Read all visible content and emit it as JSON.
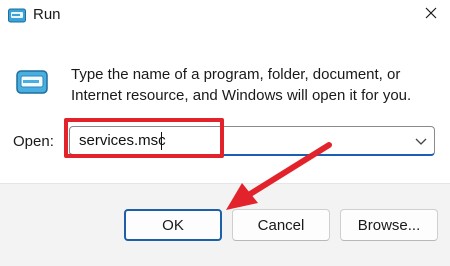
{
  "window": {
    "title": "Run",
    "close_icon": "close-icon",
    "app_icon": "run-icon"
  },
  "body": {
    "description": "Type the name of a program, folder, document, or Internet resource, and Windows will open it for you.",
    "open_label": "Open:",
    "open_value": "services.msc",
    "dropdown_icon": "chevron-down-icon"
  },
  "buttons": {
    "ok": "OK",
    "cancel": "Cancel",
    "browse": "Browse..."
  },
  "annotation": {
    "color": "#e2232b",
    "type": "arrow-pointing-to-ok"
  },
  "colors": {
    "accent": "#1d5fa8",
    "annotation": "#e2232b",
    "footer_bg": "#f3f3f3"
  }
}
